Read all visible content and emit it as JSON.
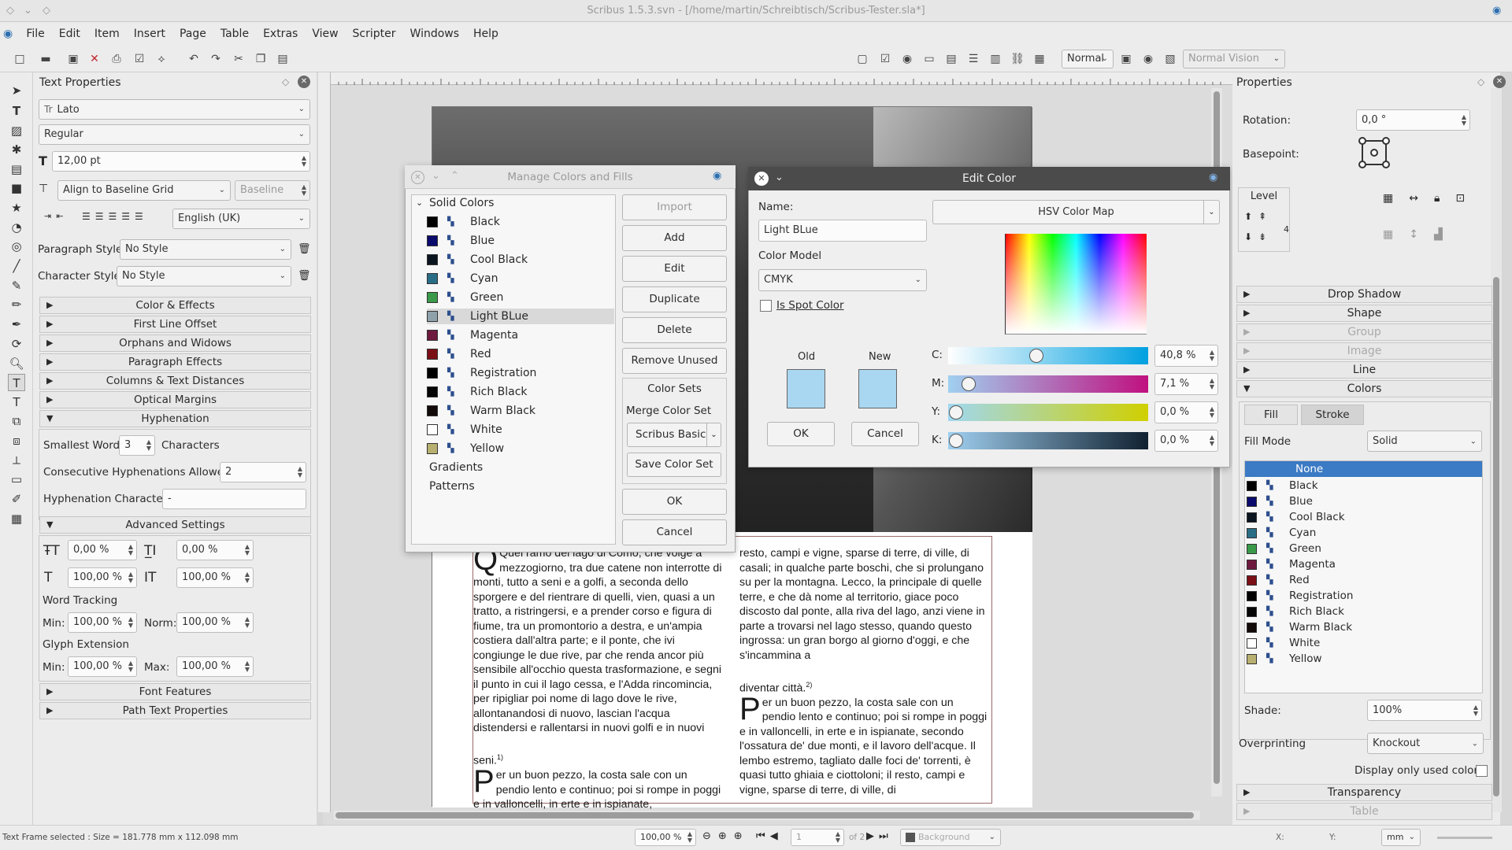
{
  "window": {
    "title": "Scribus 1.5.3.svn - [/home/martin/Schreibtisch/Scribus-Tester.sla*]"
  },
  "menu": [
    "File",
    "Edit",
    "Item",
    "Insert",
    "Page",
    "Table",
    "Extras",
    "View",
    "Scripter",
    "Windows",
    "Help"
  ],
  "toolbar": {
    "mode": "Normal",
    "vision": "Normal Vision"
  },
  "text_properties": {
    "title": "Text Properties",
    "font": "Lato",
    "font_prefix": "Tr",
    "style": "Regular",
    "size": "12,00 pt",
    "align": "Align to Baseline Grid",
    "baseline": "Baseline",
    "language": "English (UK)",
    "paragraph_style_label": "Paragraph Style:",
    "paragraph_style": "No Style",
    "character_style_label": "Character Style:",
    "character_style": "No Style",
    "sections": [
      "Color & Effects",
      "First Line Offset",
      "Orphans and Widows",
      "Paragraph Effects",
      "Columns & Text Distances",
      "Optical Margins"
    ],
    "hyphenation": {
      "title": "Hyphenation",
      "smallest_label": "Smallest Word:",
      "smallest": "3",
      "characters": "Characters",
      "consecutive_label": "Consecutive Hyphenations Allowed:",
      "consecutive": "2",
      "char_label": "Hyphenation Character:",
      "char": "-"
    },
    "advanced": {
      "title": "Advanced Settings",
      "v1": "0,00 %",
      "v2": "0,00 %",
      "v3": "100,00 %",
      "v4": "100,00 %",
      "word_tracking": "Word Tracking",
      "min_label": "Min:",
      "min": "100,00 %",
      "norm_label": "Norm:",
      "norm": "100,00 %",
      "glyph_extension": "Glyph Extension",
      "gmin_label": "Min:",
      "gmin": "100,00 %",
      "gmax_label": "Max:",
      "gmax": "100,00 %"
    },
    "font_features": "Font Features",
    "path_text": "Path Text Properties"
  },
  "manage_colors": {
    "title": "Manage Colors and Fills",
    "solid_colors": "Solid Colors",
    "colors": [
      {
        "name": "Black",
        "hex": "#000000"
      },
      {
        "name": "Blue",
        "hex": "#0b0b6e"
      },
      {
        "name": "Cool Black",
        "hex": "#0a1520"
      },
      {
        "name": "Cyan",
        "hex": "#2a6e86"
      },
      {
        "name": "Green",
        "hex": "#3a9a4a"
      },
      {
        "name": "Light BLue",
        "hex": "#8fa2ab"
      },
      {
        "name": "Magenta",
        "hex": "#6e1a3e"
      },
      {
        "name": "Red",
        "hex": "#7a1015"
      },
      {
        "name": "Registration",
        "hex": "#000000"
      },
      {
        "name": "Rich Black",
        "hex": "#050505"
      },
      {
        "name": "Warm Black",
        "hex": "#120a08"
      },
      {
        "name": "White",
        "hex": "#ffffff"
      },
      {
        "name": "Yellow",
        "hex": "#b8b070"
      }
    ],
    "gradients": "Gradients",
    "patterns": "Patterns",
    "buttons": {
      "import": "Import",
      "add": "Add",
      "edit": "Edit",
      "duplicate": "Duplicate",
      "delete": "Delete",
      "remove_unused": "Remove Unused",
      "ok": "OK",
      "cancel": "Cancel"
    },
    "color_sets": "Color Sets",
    "merge_color_set": "Merge Color Set",
    "set": "Scribus Basic",
    "save_color_set": "Save Color Set"
  },
  "edit_color": {
    "title": "Edit Color",
    "name_label": "Name:",
    "name": "Light BLue",
    "model_label": "Color Model",
    "model": "CMYK",
    "spot": "Is Spot Color",
    "map": "HSV Color Map",
    "old": "Old",
    "new": "New",
    "swatch": "#a9d6f0",
    "ok": "OK",
    "cancel": "Cancel",
    "channels": [
      {
        "label": "C:",
        "value": "40,8 %",
        "fraction": 0.408
      },
      {
        "label": "M:",
        "value": "7,1 %",
        "fraction": 0.071
      },
      {
        "label": "Y:",
        "value": "0,0 %",
        "fraction": 0
      },
      {
        "label": "K:",
        "value": "0,0 %",
        "fraction": 0
      }
    ]
  },
  "document_text": {
    "left": "Quel ramo del lago di Como, che volge a mezzogiorno, tra due catene non interrotte di monti, tutto a seni e a golfi, a seconda dello sporgere e del rientrare di quelli, vien, quasi a un tratto, a ristringersi, e a prender corso e figura di fiume, tra un promontorio a destra, e un'ampia costiera dall'altra parte; e il ponte, che ivi congiunge le due rive, par che renda ancor più sensibile all'occhio questa trasformazione, e segni il punto in cui il lago cessa, e l'Adda rincomincia, per ripigliar poi nome di lago dove le rive, allontanandosi di nuovo, lascian l'acqua distendersi e rallentarsi in nuovi golfi e in nuovi",
    "left_end": "seni.",
    "left_fn": "1)",
    "left2_drop": "P",
    "left2": "er un buon pezzo, la costa sale con un pendio lento e continuo; poi si rompe in poggi e in valloncelli, in erte e in ispianate,",
    "right": "resto, campi e vigne, sparse di terre, di ville, di casali; in qualche parte boschi, che si prolungano su per la montagna. Lecco, la principale di quelle terre, e che dà nome al territorio, giace poco discosto dal ponte, alla riva del lago, anzi viene in parte a trovarsi nel lago stesso, quando questo ingrossa: un gran borgo al giorno d'oggi, e che s'incammina a",
    "right_end": "diventar città.",
    "right_fn": "2)",
    "right2_drop": "P",
    "right2": "er un buon pezzo, la costa sale con un pendio lento e continuo; poi si rompe in poggi e in valloncelli, in erte e in ispianate, secondo l'ossatura de' due monti, e il lavoro dell'acque. Il lembo estremo, tagliato dalle foci de' torrenti, è quasi tutto ghiaia e ciottoloni; il resto, campi e vigne, sparse di terre, di ville, di"
  },
  "properties": {
    "title": "Properties",
    "rotation_label": "Rotation:",
    "rotation": "0,0 °",
    "basepoint_label": "Basepoint:",
    "level": "Level",
    "level_num": "4",
    "sections": [
      "Drop Shadow",
      "Shape",
      "Group",
      "Image",
      "Line"
    ],
    "colors": "Colors",
    "fill_tab": "Fill",
    "stroke_tab": "Stroke",
    "fill_mode_label": "Fill Mode",
    "fill_mode": "Solid",
    "none": "None",
    "list": [
      {
        "name": "Black",
        "hex": "#000000"
      },
      {
        "name": "Blue",
        "hex": "#0b0b6e"
      },
      {
        "name": "Cool Black",
        "hex": "#0a1520"
      },
      {
        "name": "Cyan",
        "hex": "#2a6e86"
      },
      {
        "name": "Green",
        "hex": "#3a9a4a"
      },
      {
        "name": "Magenta",
        "hex": "#6e1a3e"
      },
      {
        "name": "Red",
        "hex": "#7a1015"
      },
      {
        "name": "Registration",
        "hex": "#000000"
      },
      {
        "name": "Rich Black",
        "hex": "#050505"
      },
      {
        "name": "Warm Black",
        "hex": "#120a08"
      },
      {
        "name": "White",
        "hex": "#ffffff"
      },
      {
        "name": "Yellow",
        "hex": "#b8b070"
      }
    ],
    "shade_label": "Shade:",
    "shade": "100%",
    "overprinting_label": "Overprinting",
    "overprinting": "Knockout",
    "used_only": "Display only used colors",
    "transparency": "Transparency",
    "table": "Table"
  },
  "status": {
    "text": "Text Frame selected : Size = 181.778 mm x 112.098 mm",
    "zoom": "100,00 %",
    "page": "1",
    "of": "of 2",
    "layer": "Background",
    "x": "X:",
    "y": "Y:",
    "unit": "mm"
  }
}
